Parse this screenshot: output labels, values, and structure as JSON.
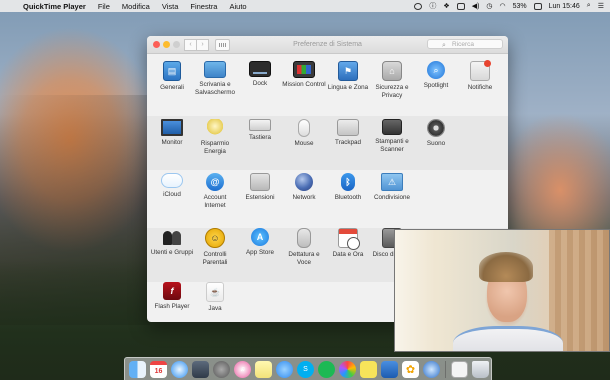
{
  "menubar": {
    "app_name": "QuickTime Player",
    "menus": [
      "File",
      "Modifica",
      "Vista",
      "Finestra",
      "Aiuto"
    ],
    "battery": "53%",
    "clock": "Lun 15:46"
  },
  "window": {
    "title": "Preferenze di Sistema",
    "search_placeholder": "Ricerca"
  },
  "prefs": {
    "row1": [
      "Generali",
      "Scrivania e Salvaschermo",
      "Dock",
      "Mission Control",
      "Lingua e Zona",
      "Sicurezza e Privacy",
      "Spotlight",
      "Notifiche"
    ],
    "row2": [
      "Monitor",
      "Risparmio Energia",
      "Tastiera",
      "Mouse",
      "Trackpad",
      "Stampanti e Scanner",
      "Suono"
    ],
    "row3": [
      "iCloud",
      "Account Internet",
      "Estensioni",
      "Network",
      "Bluetooth",
      "Condivisione"
    ],
    "row4": [
      "Utenti e Gruppi",
      "Controlli Parentali",
      "App Store",
      "Dettatura e Voce",
      "Data e Ora",
      "Disco di avvio"
    ],
    "row5": [
      "Flash Player",
      "Java"
    ]
  },
  "dock": {
    "calendar_day": "16"
  }
}
